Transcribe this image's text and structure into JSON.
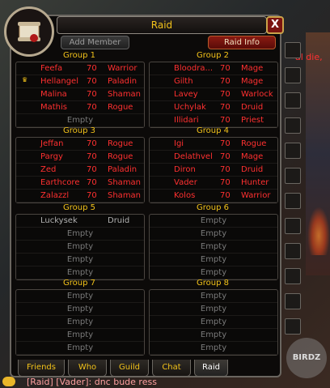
{
  "window": {
    "title": "Raid",
    "close_label": "X"
  },
  "buttons": {
    "add_member": "Add Member",
    "raid_info": "Raid Info"
  },
  "groups": [
    {
      "header": "Group 1",
      "rows": [
        {
          "name": "Feefa",
          "level": "70",
          "cls": "Warrior",
          "style": "red"
        },
        {
          "name": "Hellangel",
          "level": "70",
          "cls": "Paladin",
          "style": "red",
          "leader": true
        },
        {
          "name": "Malina",
          "level": "70",
          "cls": "Shaman",
          "style": "red"
        },
        {
          "name": "Mathis",
          "level": "70",
          "cls": "Rogue",
          "style": "red"
        },
        {
          "name": "Empty",
          "style": "empty"
        }
      ]
    },
    {
      "header": "Group 2",
      "rows": [
        {
          "name": "Bloodra...",
          "level": "70",
          "cls": "Mage",
          "style": "red"
        },
        {
          "name": "Gilth",
          "level": "70",
          "cls": "Mage",
          "style": "red"
        },
        {
          "name": "Lavey",
          "level": "70",
          "cls": "Warlock",
          "style": "red"
        },
        {
          "name": "Uchylak",
          "level": "70",
          "cls": "Druid",
          "style": "red"
        },
        {
          "name": "Illidari",
          "level": "70",
          "cls": "Priest",
          "style": "red"
        }
      ]
    },
    {
      "header": "Group 3",
      "rows": [
        {
          "name": "Jeffan",
          "level": "70",
          "cls": "Rogue",
          "style": "red"
        },
        {
          "name": "Pargy",
          "level": "70",
          "cls": "Rogue",
          "style": "red"
        },
        {
          "name": "Zed",
          "level": "70",
          "cls": "Paladin",
          "style": "red"
        },
        {
          "name": "Earthcore",
          "level": "70",
          "cls": "Shaman",
          "style": "red"
        },
        {
          "name": "Zalazzl",
          "level": "70",
          "cls": "Shaman",
          "style": "red"
        }
      ]
    },
    {
      "header": "Group 4",
      "rows": [
        {
          "name": "Igi",
          "level": "70",
          "cls": "Rogue",
          "style": "red"
        },
        {
          "name": "Delathvel",
          "level": "70",
          "cls": "Mage",
          "style": "red"
        },
        {
          "name": "Diron",
          "level": "70",
          "cls": "Druid",
          "style": "red"
        },
        {
          "name": "Vader",
          "level": "70",
          "cls": "Hunter",
          "style": "red"
        },
        {
          "name": "Kolos",
          "level": "70",
          "cls": "Warrior",
          "style": "red"
        }
      ]
    },
    {
      "header": "Group 5",
      "rows": [
        {
          "name": "Luckysek",
          "level": "",
          "cls": "Druid",
          "style": "gray"
        },
        {
          "name": "Empty",
          "style": "empty"
        },
        {
          "name": "Empty",
          "style": "empty"
        },
        {
          "name": "Empty",
          "style": "empty"
        },
        {
          "name": "Empty",
          "style": "empty"
        }
      ]
    },
    {
      "header": "Group 6",
      "rows": [
        {
          "name": "Empty",
          "style": "empty"
        },
        {
          "name": "Empty",
          "style": "empty"
        },
        {
          "name": "Empty",
          "style": "empty"
        },
        {
          "name": "Empty",
          "style": "empty"
        },
        {
          "name": "Empty",
          "style": "empty"
        }
      ]
    },
    {
      "header": "Group 7",
      "rows": [
        {
          "name": "Empty",
          "style": "empty"
        },
        {
          "name": "Empty",
          "style": "empty"
        },
        {
          "name": "Empty",
          "style": "empty"
        },
        {
          "name": "Empty",
          "style": "empty"
        },
        {
          "name": "Empty",
          "style": "empty"
        }
      ]
    },
    {
      "header": "Group 8",
      "rows": [
        {
          "name": "Empty",
          "style": "empty"
        },
        {
          "name": "Empty",
          "style": "empty"
        },
        {
          "name": "Empty",
          "style": "empty"
        },
        {
          "name": "Empty",
          "style": "empty"
        },
        {
          "name": "Empty",
          "style": "empty"
        }
      ]
    }
  ],
  "tabs": [
    {
      "label": "Friends"
    },
    {
      "label": "Who"
    },
    {
      "label": "Guild"
    },
    {
      "label": "Chat"
    },
    {
      "label": "Raid",
      "active": true
    }
  ],
  "chat": {
    "line": "[Raid] [Vader]: dnc bude ress"
  },
  "background_text": {
    "raid_warning": "al die,"
  },
  "watermark": "BIRDZ",
  "colors": {
    "accent_gold": "#f2c21a",
    "member_red": "#ff3030",
    "empty_gray": "#7a7a7a",
    "close_red": "#7a1410"
  }
}
